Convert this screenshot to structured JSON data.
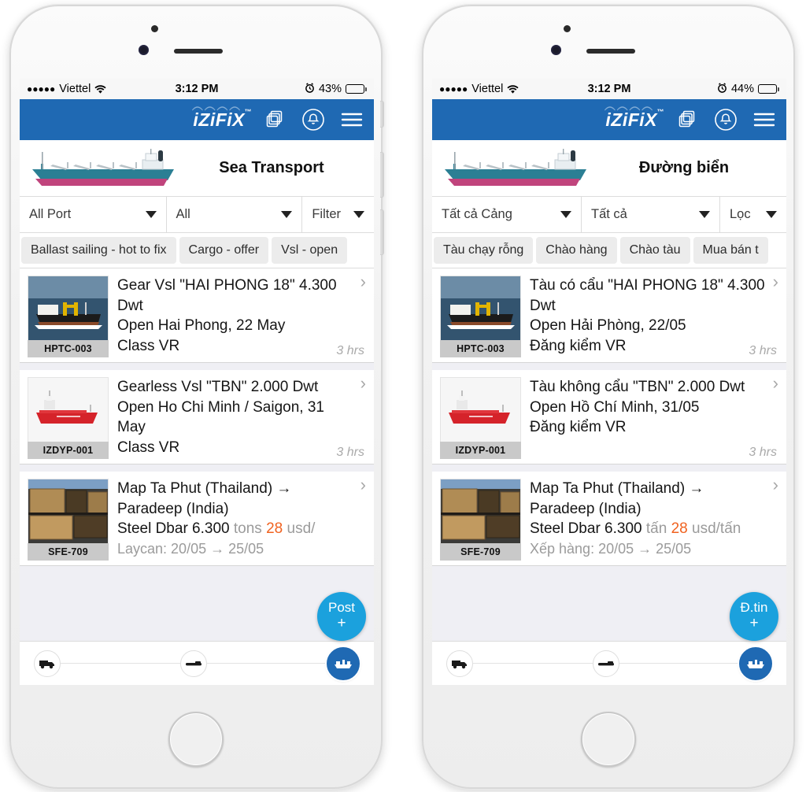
{
  "colors": {
    "nav_blue": "#1f69b3",
    "fab_blue": "#1ba1dd",
    "price_orange": "#f0621f",
    "tab_grey": "#ececec",
    "label_grey": "#c9c9c9"
  },
  "phones": [
    {
      "id": "left",
      "status_bar": {
        "signal_dots": "●●●●●",
        "carrier": "Viettel",
        "wifi_icon": "wifi-icon",
        "time": "3:12 PM",
        "alarm_icon": "alarm-clock-icon",
        "battery_percent": "43%",
        "battery_level": 43
      },
      "navbar": {
        "logo": "iZiFiX",
        "logo_tm": "™",
        "icons": [
          "copy-pages-icon",
          "notification-bell-icon",
          "hamburger-menu-icon"
        ]
      },
      "banner": {
        "title": "Sea Transport",
        "image": "cargo-ship-illustration"
      },
      "filters": [
        {
          "name": "port-filter",
          "value": "All Port"
        },
        {
          "name": "type-filter",
          "value": "All"
        },
        {
          "name": "filter-button",
          "value": "Filter"
        }
      ],
      "tabs": [
        {
          "label": "Ballast sailing - hot to fix",
          "selected": false
        },
        {
          "label": "Cargo - offer",
          "selected": false
        },
        {
          "label": "Vsl - open",
          "selected": false
        }
      ],
      "listings": [
        {
          "code": "HPTC-003",
          "thumb": "bulk-carrier-yellow-cranes-photo",
          "lines": [
            {
              "text": "Gear Vsl \"HAI PHONG 18\" 4.300 Dwt",
              "style": "normal"
            },
            {
              "text": "Open Hai Phong, 22 May",
              "style": "normal"
            },
            {
              "text": "Class VR",
              "style": "normal"
            }
          ],
          "age": "3 hrs"
        },
        {
          "code": "IZDYP-001",
          "thumb": "red-general-cargo-ship-photo",
          "lines": [
            {
              "text": "Gearless Vsl \"TBN\" 2.000 Dwt",
              "style": "normal"
            },
            {
              "text": "Open Ho Chi Minh / Saigon, 31 May",
              "style": "normal"
            },
            {
              "text": "Class VR",
              "style": "normal"
            }
          ],
          "age": "3 hrs"
        },
        {
          "code": "SFE-709",
          "thumb": "wooden-crates-cargo-photo",
          "route": "Map Ta Phut (Thailand) → Paradeep (India)",
          "cargo_name": "Steel Dbar 6.300",
          "cargo_unit": "tons",
          "cargo_price": "28",
          "cargo_price_unit": "usd/",
          "laycan": "Laycan: 20/05 → 25/05",
          "age": ""
        }
      ],
      "fab": {
        "label": "Post",
        "plus": "+"
      },
      "toolbar": [
        {
          "name": "road-transport-icon",
          "active": false
        },
        {
          "name": "rail-transport-icon",
          "active": false
        },
        {
          "name": "sea-transport-icon",
          "active": true
        }
      ]
    },
    {
      "id": "right",
      "status_bar": {
        "signal_dots": "●●●●●",
        "carrier": "Viettel",
        "wifi_icon": "wifi-icon",
        "time": "3:12 PM",
        "alarm_icon": "alarm-clock-icon",
        "battery_percent": "44%",
        "battery_level": 44
      },
      "navbar": {
        "logo": "iZiFiX",
        "logo_tm": "™",
        "icons": [
          "copy-pages-icon",
          "notification-bell-icon",
          "hamburger-menu-icon"
        ]
      },
      "banner": {
        "title": "Đường biển",
        "image": "cargo-ship-illustration"
      },
      "filters": [
        {
          "name": "port-filter",
          "value": "Tất cả Cảng"
        },
        {
          "name": "type-filter",
          "value": "Tất cả"
        },
        {
          "name": "filter-button",
          "value": "Lọc"
        }
      ],
      "tabs": [
        {
          "label": "Tàu chạy rỗng",
          "selected": false
        },
        {
          "label": "Chào hàng",
          "selected": false
        },
        {
          "label": "Chào tàu",
          "selected": false
        },
        {
          "label": "Mua bán t",
          "selected": false
        }
      ],
      "listings": [
        {
          "code": "HPTC-003",
          "thumb": "bulk-carrier-yellow-cranes-photo",
          "lines": [
            {
              "text": "Tàu có cẩu \"HAI PHONG 18\" 4.300 Dwt",
              "style": "normal"
            },
            {
              "text": "Open Hải Phòng, 22/05",
              "style": "normal"
            },
            {
              "text": "Đăng kiểm VR",
              "style": "normal"
            }
          ],
          "age": "3 hrs"
        },
        {
          "code": "IZDYP-001",
          "thumb": "red-general-cargo-ship-photo",
          "lines": [
            {
              "text": "Tàu không cẩu \"TBN\" 2.000 Dwt",
              "style": "normal"
            },
            {
              "text": "Open Hồ Chí Minh, 31/05",
              "style": "normal"
            },
            {
              "text": "Đăng kiểm VR",
              "style": "normal"
            }
          ],
          "age": "3 hrs"
        },
        {
          "code": "SFE-709",
          "thumb": "wooden-crates-cargo-photo",
          "route": "Map Ta Phut (Thailand) → Paradeep (India)",
          "cargo_name": "Steel Dbar 6.300",
          "cargo_unit": "tấn",
          "cargo_price": "28",
          "cargo_price_unit": "usd/tấn",
          "laycan": "Xếp hàng: 20/05 → 25/05",
          "age": ""
        }
      ],
      "fab": {
        "label": "Đ.tin",
        "plus": "+"
      },
      "toolbar": [
        {
          "name": "road-transport-icon",
          "active": false
        },
        {
          "name": "rail-transport-icon",
          "active": false
        },
        {
          "name": "sea-transport-icon",
          "active": true
        }
      ]
    }
  ]
}
